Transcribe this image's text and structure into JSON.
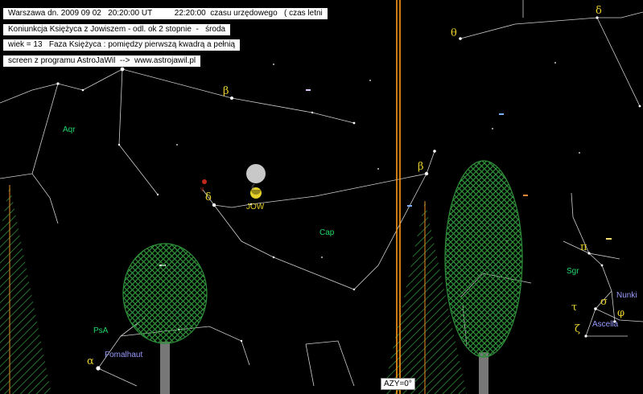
{
  "info_lines": {
    "line1": "Warszawa dn. 2009 09 02   20:20:00 UT          22:20:00  czasu urzędowego   ( czas letni",
    "line2": "Koniunkcja Księżyca z Jowiszem - odl. ok 2 stopnie  -   środa",
    "line3": "wiek = 13   Faza Księżyca : pomiędzy pierwszą kwadrą a pełnią",
    "line4": "screen z programu AstroJaWil  -->  www.astrojawil.pl"
  },
  "constellations": {
    "aqr": "Aqr",
    "cap": "Cap",
    "psa": "PsA",
    "sgr": "Sgr"
  },
  "stars": {
    "fomalhaut": "Fomalhaut",
    "nunki": "Nunki",
    "ascella": "Ascella"
  },
  "planets": {
    "jupiter": "JOW",
    "neptune_glyph": "♆",
    "moon_glyph": "☾"
  },
  "greek": {
    "theta": "θ",
    "delta_top": "δ",
    "beta_aqr": "β",
    "beta_cap": "β",
    "delta_cap": "δ",
    "pi": "π",
    "sigma": "σ",
    "tau": "τ",
    "phi": "φ",
    "zeta": "ζ",
    "alpha": "α"
  },
  "azimuth": "AZY=0°",
  "colors": {
    "sky": "#000000",
    "lines": "#cfcfcf",
    "tree_green": "#2e8f3a",
    "trunk": "#777777",
    "meridian": "#ff9a1a",
    "labels_green": "#1fd66a",
    "labels_blue": "#9a9cff",
    "greek_yellow": "#e6d02a"
  }
}
